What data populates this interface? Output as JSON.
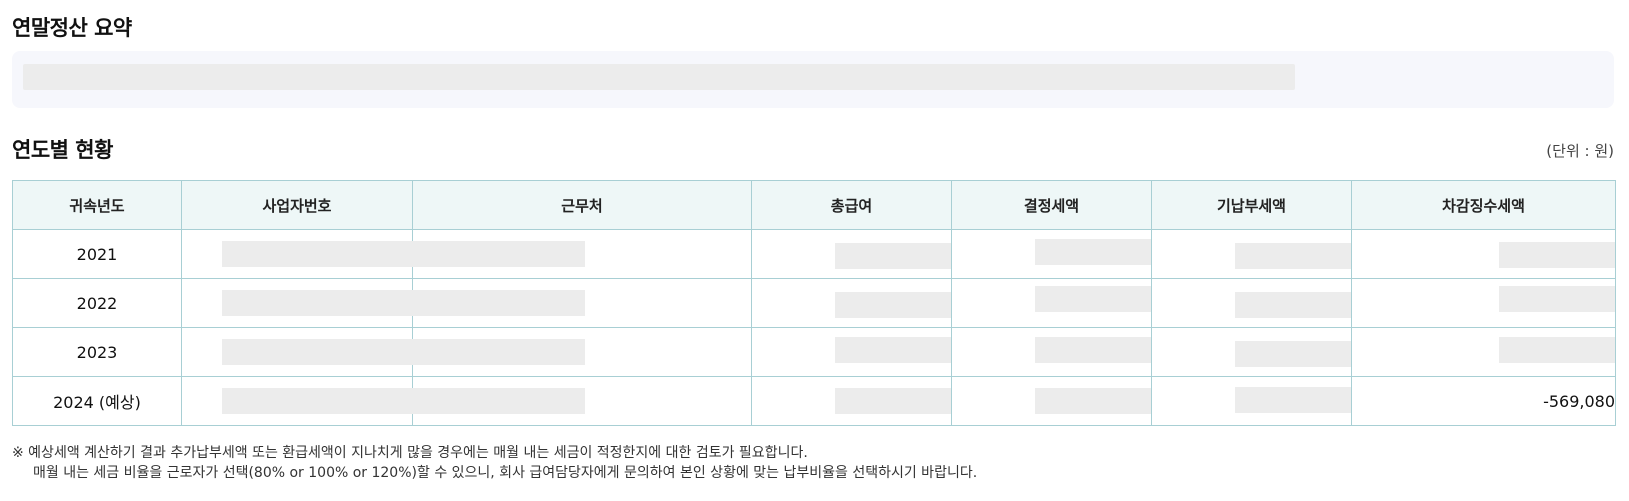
{
  "summary": {
    "title": "연말정산 요약"
  },
  "yearly": {
    "title": "연도별 현황",
    "unit_label": "(단위 : 원)",
    "columns": [
      "귀속년도",
      "사업자번호",
      "근무처",
      "총급여",
      "결정세액",
      "기납부세액",
      "차감징수세액"
    ],
    "rows": [
      {
        "year": "2021",
        "deduction": ""
      },
      {
        "year": "2022",
        "deduction": ""
      },
      {
        "year": "2023",
        "deduction": ""
      },
      {
        "year": "2024 (예상)",
        "deduction": "-569,080"
      }
    ]
  },
  "notice": {
    "line1": "※ 예상세액 계산하기 결과 추가납부세액 또는 환급세액이 지나치게 많을 경우에는 매월 내는 세금이 적정한지에 대한 검토가 필요합니다.",
    "line2": "매월 내는 세금 비율을 근로자가 선택(80% or 100% or 120%)할 수 있으니, 회사 급여담당자에게 문의하여 본인 상황에 맞는 납부비율을 선택하시기 바랍니다."
  },
  "colors": {
    "header_bg": "#eef7f7",
    "border": "#a8cfd4",
    "summary_bg": "#f6f7fc",
    "mask": "#ececec"
  }
}
